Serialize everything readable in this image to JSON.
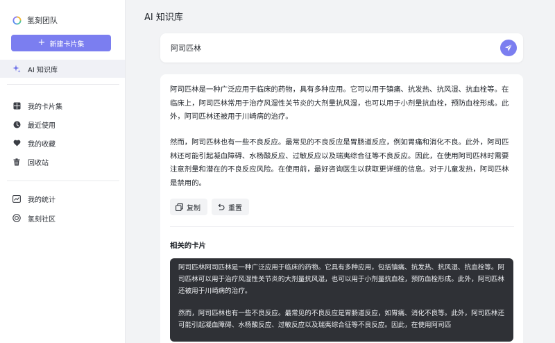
{
  "sidebar": {
    "brand": "氢刻团队",
    "new_button": "新建卡片集",
    "items": [
      {
        "label": "AI 知识库",
        "icon": "sparkle-icon"
      },
      {
        "label": "我的卡片集",
        "icon": "grid-icon"
      },
      {
        "label": "最近使用",
        "icon": "clock-icon"
      },
      {
        "label": "我的收藏",
        "icon": "heart-icon"
      },
      {
        "label": "回收站",
        "icon": "trash-icon"
      },
      {
        "label": "我的统计",
        "icon": "chart-icon"
      },
      {
        "label": "氢刻社区",
        "icon": "community-icon"
      }
    ]
  },
  "header": {
    "title": "AI 知识库"
  },
  "search": {
    "value": "阿司匹林"
  },
  "answer": {
    "paragraphs": [
      "阿司匹林是一种广泛应用于临床的药物，具有多种应用。它可以用于镇痛、抗发热、抗风湿、抗血栓等。在临床上，阿司匹林常用于治疗风湿性关节炎的大剂量抗风湿，也可以用于小剂量抗血栓，预防血栓形成。此外，阿司匹林还被用于川崎病的治疗。",
      "然而，阿司匹林也有一些不良反应。最常见的不良反应是胃肠道反应，例如胃痛和消化不良。此外，阿司匹林还可能引起凝血障碍、水杨酸反应、过敏反应以及瑞夷综合征等不良反应。因此，在使用阿司匹林时需要注意剂量和潜在的不良反应风险。在使用前，最好咨询医生以获取更详细的信息。对于儿童发热，阿司匹林是禁用的。"
    ],
    "copy_label": "复制",
    "reset_label": "重置"
  },
  "related": {
    "title": "相关的卡片",
    "card_paragraphs": [
      "阿司匹林阿司匹林是一种广泛应用于临床的药物。它具有多种应用，包括镇痛、抗发热、抗风湿、抗血栓等。阿司匹林可以用于治疗风湿性关节炎的大剂量抗风湿，也可以用于小剂量抗血栓，预防血栓形成。此外，阿司匹林还被用于川崎病的治疗。",
      "然而，阿司匹林也有一些不良反应。最常见的不良反应是胃肠道反应，如胃痛、消化不良等。此外，阿司匹林还可能引起凝血障碍、水杨酸反应、过敏反应以及瑞夷综合征等不良反应。因此，在使用阿司匹"
    ]
  },
  "colors": {
    "accent": "#7b7ef0",
    "background": "#f2f3f5",
    "card_dark": "#2f3136"
  }
}
